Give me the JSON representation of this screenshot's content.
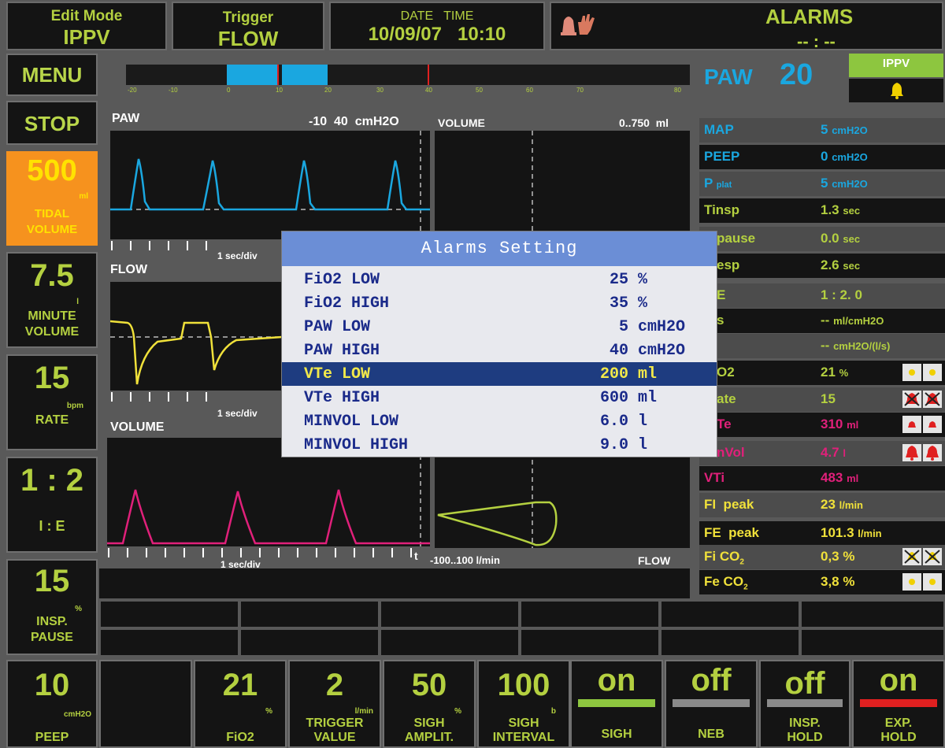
{
  "header": {
    "edit_mode_label": "Edit Mode",
    "edit_mode_value": "IPPV",
    "trigger_label": "Trigger",
    "trigger_value": "FLOW",
    "date_label": "DATE",
    "time_label": "TIME",
    "date_value": "10/09/07",
    "time_value": "10:10",
    "alarms_label": "ALARMS",
    "alarms_value": "-- : --"
  },
  "left": {
    "menu": "MENU",
    "stop": "STOP",
    "tidal_value": "500",
    "tidal_unit": "ml",
    "tidal_label_1": "TIDAL",
    "tidal_label_2": "VOLUME",
    "minute_value": "7.5",
    "minute_unit": "l",
    "minute_label_1": "MINUTE",
    "minute_label_2": "VOLUME",
    "rate_value": "15",
    "rate_unit": "bpm",
    "rate_label": "RATE",
    "ie_value": "1 : 2",
    "ie_label": "I : E",
    "pause_value": "15",
    "pause_unit": "%",
    "pause_label_1": "INSP.",
    "pause_label_2": "PAUSE",
    "peep_value": "10",
    "peep_unit": "cmH2O",
    "peep_label": "PEEP"
  },
  "pressure_bar": {
    "ticks": [
      "-20",
      "-10",
      "0",
      "10",
      "20",
      "30",
      "40",
      "50",
      "60",
      "70",
      "80"
    ]
  },
  "charts": {
    "paw_title": "PAW",
    "paw_range": "-10  40  cmH2O",
    "volume_title": "VOLUME",
    "volume_range": "0..750  ml",
    "flow_title": "FLOW",
    "vol2_title": "VOLUME",
    "time_div_1": "1 sec/div",
    "time_div_2": "1 sec/div",
    "time_div_3": "1 sec/div",
    "t_label": "t",
    "loop_range": "-100..100 l/min",
    "loop_axis": "FLOW"
  },
  "right": {
    "paw_label": "PAW",
    "paw_value": "20",
    "mode_badge": "IPPV",
    "params": [
      {
        "name": "MAP",
        "value": "5",
        "unit": "cmH2O"
      },
      {
        "name": "PEEP",
        "value": "0",
        "unit": "cmH2O"
      },
      {
        "name": "P",
        "sub": "plat",
        "value": "5",
        "unit": "cmH2O"
      },
      {
        "name": "Tinsp",
        "value": "1.3",
        "unit": "sec"
      },
      {
        "name": "pause",
        "value": "0.0",
        "unit": "sec"
      },
      {
        "name": "esp",
        "value": "2.6",
        "unit": "sec"
      },
      {
        "name": "E",
        "value": "1 : 2. 0",
        "unit": ""
      },
      {
        "name": "s",
        "value": "--",
        "unit": "ml/cmH2O"
      },
      {
        "name": "",
        "value": "--",
        "unit": "cmH2O/(l/s)"
      },
      {
        "name": "O2",
        "value": "21",
        "unit": "%"
      },
      {
        "name": "ate",
        "value": "15",
        "unit": ""
      },
      {
        "name": "Te",
        "value": "310",
        "unit": "ml"
      },
      {
        "name": "nVol",
        "value": "4.7",
        "unit": "l"
      },
      {
        "name": "VTi",
        "value": "483",
        "unit": "ml"
      },
      {
        "name": "FI  peak",
        "value": "23",
        "unit": "l/min"
      },
      {
        "name": "FE  peak",
        "value": "101.3",
        "unit": "l/min"
      },
      {
        "name": "Fi CO",
        "sub": "2",
        "value": "0,3",
        "unit": "%"
      },
      {
        "name": "Fe CO",
        "sub": "2",
        "value": "3,8",
        "unit": "%"
      }
    ]
  },
  "modal": {
    "title": "Alarms Setting",
    "rows": [
      {
        "name": "FiO2 LOW",
        "value": "25",
        "unit": "%"
      },
      {
        "name": "FiO2 HIGH",
        "value": "35",
        "unit": "%"
      },
      {
        "name": "PAW LOW",
        "value": "5",
        "unit": "cmH2O"
      },
      {
        "name": "PAW HIGH",
        "value": "40",
        "unit": "cmH2O"
      },
      {
        "name": "VTe LOW",
        "value": "200",
        "unit": "ml"
      },
      {
        "name": "VTe HIGH",
        "value": "600",
        "unit": "ml"
      },
      {
        "name": "MINVOL LOW",
        "value": "6.0",
        "unit": "l"
      },
      {
        "name": "MINVOL HIGH",
        "value": "9.0",
        "unit": "l"
      }
    ],
    "selected_index": 4
  },
  "bottom": {
    "fio2_value": "21",
    "fio2_unit": "%",
    "fio2_label": "FiO2",
    "trig_value": "2",
    "trig_unit": "l/min",
    "trig_label_1": "TRIGGER",
    "trig_label_2": "VALUE",
    "sigha_value": "50",
    "sigha_unit": "%",
    "sigha_label_1": "SIGH",
    "sigha_label_2": "AMPLIT.",
    "sighi_value": "100",
    "sighi_unit": "b",
    "sighi_label_1": "SIGH",
    "sighi_label_2": "INTERVAL",
    "sigh_value": "on",
    "sigh_label": "SIGH",
    "neb_value": "off",
    "neb_label": "NEB",
    "ihold_value": "off",
    "ihold_label_1": "INSP.",
    "ihold_label_2": "HOLD",
    "ehold_value": "on",
    "ehold_label_1": "EXP.",
    "ehold_label_2": "HOLD"
  },
  "colors": {
    "accent_green": "#b4d040",
    "cyan": "#1aa7e0",
    "yellow": "#f0e13a",
    "pink": "#e0207a",
    "tidal_orange": "#f6921e",
    "modal_title": "#6b8ed6",
    "modal_selected": "#1e3c80",
    "exp_hold_bar": "#e02020"
  }
}
